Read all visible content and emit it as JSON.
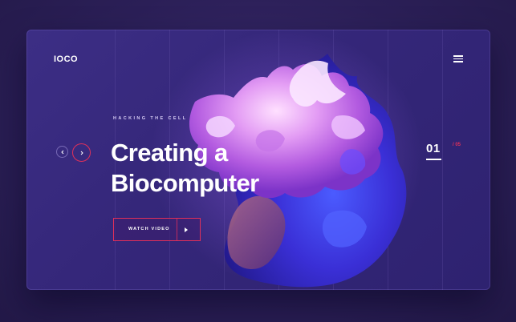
{
  "brand": {
    "logo_text": "IOCO"
  },
  "header": {
    "menu_icon": "hamburger-menu-icon"
  },
  "hero": {
    "eyebrow": "HACKING THE CELL",
    "title_line1": "Creating a",
    "title_line2": "Biocomputer",
    "cta_label": "WATCH VIDEO",
    "cta_icon": "play-icon"
  },
  "slider": {
    "prev_icon": "chevron-left-icon",
    "next_icon": "chevron-right-icon",
    "current": "01",
    "total": "/ 05"
  },
  "colors": {
    "accent": "#e0305a",
    "card_background": "#35277a",
    "page_background": "#2b1f57",
    "text": "#ffffff"
  }
}
